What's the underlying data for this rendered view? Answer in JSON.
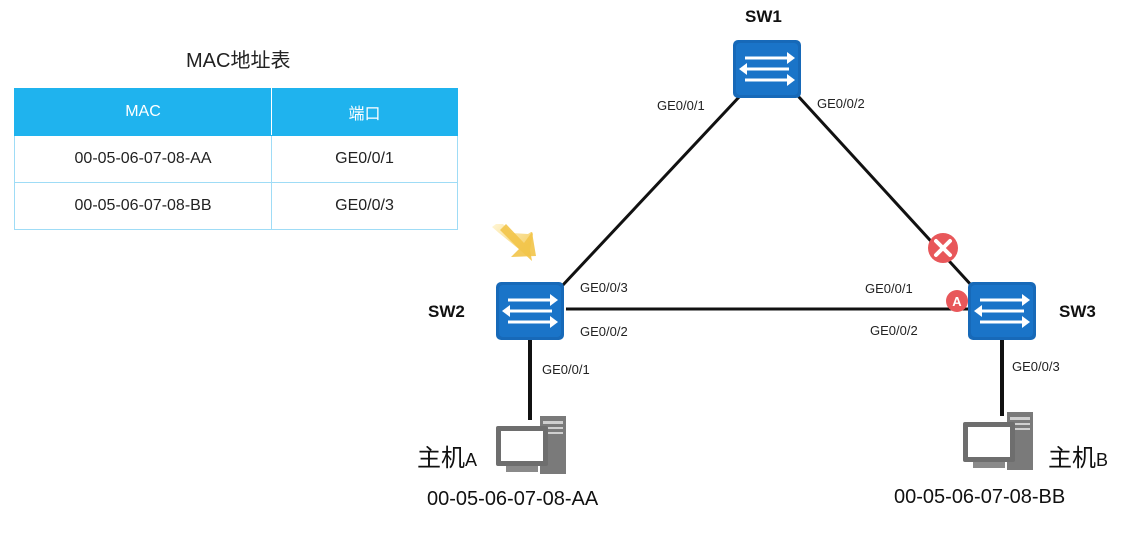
{
  "mac_table": {
    "title": "MAC地址表",
    "headers": [
      "MAC",
      "端口"
    ],
    "rows": [
      {
        "mac": "00-05-06-07-08-AA",
        "port": "GE0/0/1"
      },
      {
        "mac": "00-05-06-07-08-BB",
        "port": "GE0/0/3"
      }
    ]
  },
  "switches": {
    "sw1": {
      "name": "SW1"
    },
    "sw2": {
      "name": "SW2"
    },
    "sw3": {
      "name": "SW3"
    }
  },
  "ports": {
    "sw1_left": "GE0/0/1",
    "sw1_right": "GE0/0/2",
    "sw2_top": "GE0/0/3",
    "sw2_mid": "GE0/0/2",
    "sw2_down": "GE0/0/1",
    "sw3_top": "GE0/0/1",
    "sw3_mid": "GE0/0/2",
    "sw3_down": "GE0/0/3"
  },
  "hosts": {
    "a": {
      "name": "主机",
      "suffix": "A",
      "mac": "00-05-06-07-08-AA"
    },
    "b": {
      "name": "主机",
      "suffix": "B",
      "mac": "00-05-06-07-08-BB"
    }
  },
  "marker_a": {
    "label": "A"
  },
  "colors": {
    "switch_blue": "#1769b8",
    "table_header": "#1fb3ee",
    "blocked_red": "#e8575a",
    "arrow_yellow": "#f6d36a"
  },
  "icons": [
    "switch-icon",
    "computer-icon",
    "blocked-x-icon",
    "highlight-arrow-icon"
  ]
}
